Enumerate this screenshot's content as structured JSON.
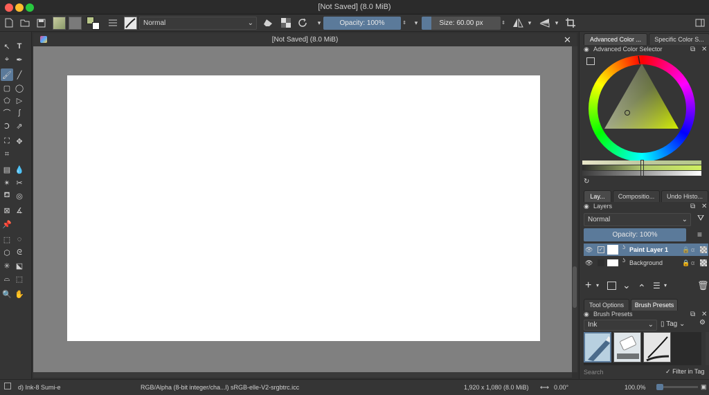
{
  "window": {
    "title": "[Not Saved]  (8.0 MiB)"
  },
  "toolbar": {
    "blend_mode": "Normal",
    "opacity_label": "Opacity: 100%",
    "opacity_value": 1.0,
    "size_label": "Size: 60.00 px",
    "size_value": 0.12
  },
  "document": {
    "tab_title": "[Not Saved]  (8.0 MiB)"
  },
  "docker_top": {
    "tabs": [
      "Advanced Color ...",
      "Specific Color S..."
    ],
    "panel_title": "Advanced Color Selector"
  },
  "docker_mid": {
    "tabs": [
      "Lay...",
      "Compositio...",
      "Undo Histo..."
    ],
    "panel_title": "Layers",
    "blend_mode": "Normal",
    "opacity_label": "Opacity:  100%",
    "layers": [
      {
        "name": "Paint Layer 1"
      },
      {
        "name": "Background"
      }
    ]
  },
  "docker_bottom": {
    "tabs": [
      "Tool Options",
      "Brush Presets"
    ],
    "panel_title": "Brush Presets",
    "tag_combo": "Ink",
    "tag_label": "Tag",
    "search_placeholder": "Search",
    "filter_label": "Filter in Tag"
  },
  "status": {
    "brush": "d) Ink-8 Sumi-e",
    "color_model": "RGB/Alpha (8-bit integer/cha...l)  sRGB-elle-V2-srgbtrc.icc",
    "dimensions": "1,920 x 1,080 (8.0 MiB)",
    "rotation": "0.00°",
    "zoom": "100.0%"
  },
  "colors": {
    "accent": "#5b7a9a",
    "canvas_bg": "#808080",
    "panel": "#353535"
  }
}
